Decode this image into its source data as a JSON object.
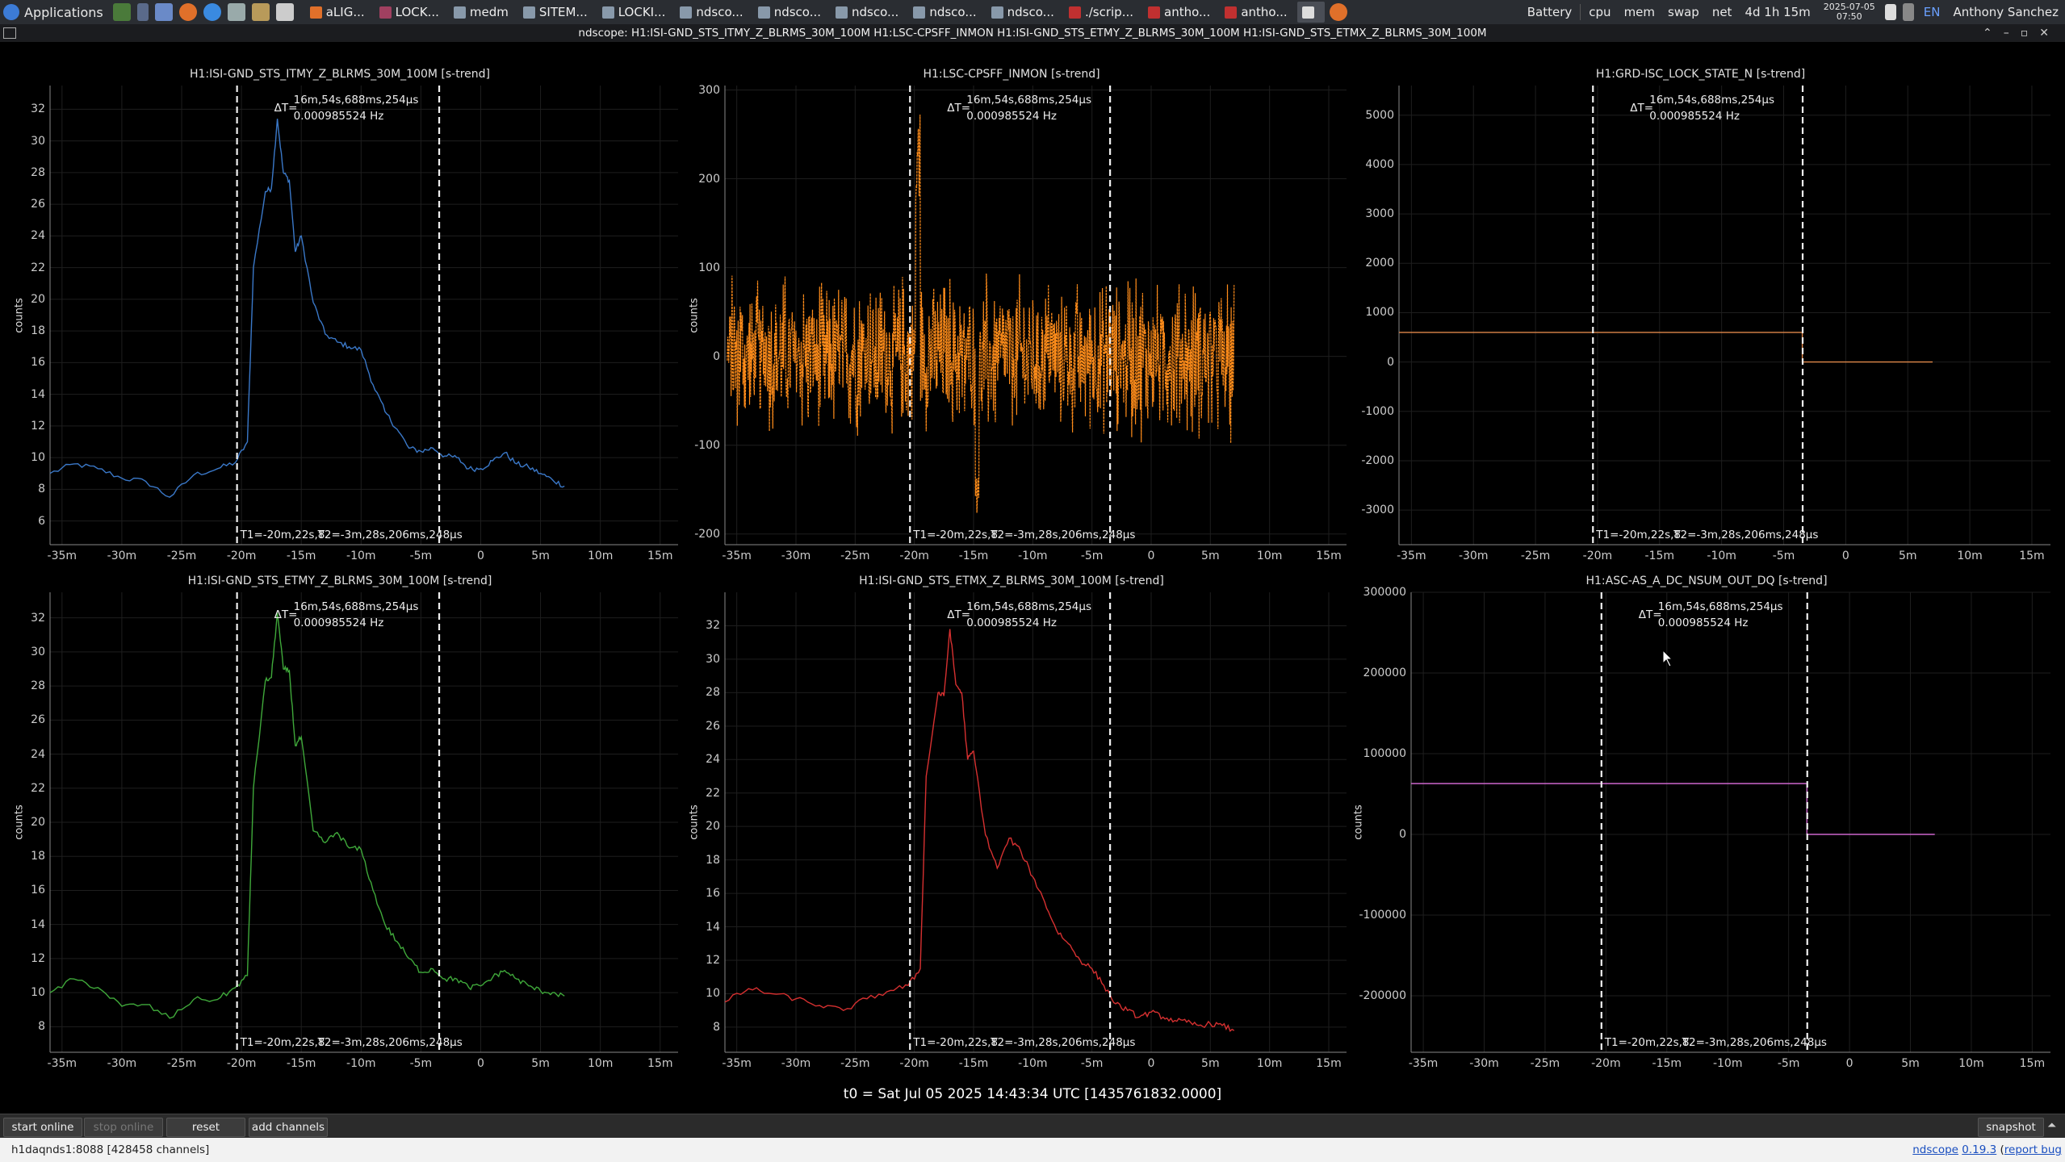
{
  "panel": {
    "applications_label": "Applications",
    "tasks": [
      {
        "label": "aLIG...",
        "icon": "firefox-icon"
      },
      {
        "label": "LOCK...",
        "icon": "x-icon"
      },
      {
        "label": "medm",
        "icon": "window-icon"
      },
      {
        "label": "SITEM...",
        "icon": "window-icon"
      },
      {
        "label": "LOCKI...",
        "icon": "window-icon"
      },
      {
        "label": "ndsco...",
        "icon": "window-icon"
      },
      {
        "label": "ndsco...",
        "icon": "window-icon"
      },
      {
        "label": "ndsco...",
        "icon": "window-icon"
      },
      {
        "label": "ndsco...",
        "icon": "window-icon"
      },
      {
        "label": "ndsco...",
        "icon": "window-icon"
      },
      {
        "label": "./scrip...",
        "icon": "terminal-icon"
      },
      {
        "label": "antho...",
        "icon": "terminal-icon"
      },
      {
        "label": "antho...",
        "icon": "terminal-icon"
      }
    ],
    "tray": {
      "battery": "Battery",
      "cpu": "cpu",
      "mem": "mem",
      "swap": "swap",
      "net": "net",
      "uptime": "4d 1h 15m",
      "date": "2025-07-05",
      "time": "07:50",
      "lang": "EN",
      "user": "Anthony Sanchez"
    }
  },
  "window": {
    "title": "ndscope: H1:ISI-GND_STS_ITMY_Z_BLRMS_30M_100M H1:LSC-CPSFF_INMON H1:ISI-GND_STS_ETMY_Z_BLRMS_30M_100M H1:ISI-GND_STS_ETMX_Z_BLRMS_30M_100M"
  },
  "cursors": {
    "delta_symbol": "ΔT=",
    "delta": "16m,54s,688ms,254μs",
    "freq": "0.000985524 Hz",
    "t1_full": "T1=-20m,22s,8",
    "t2_full": "T2=-3m,28s,206ms,248μs",
    "t1_value_min": -20.37,
    "t2_value_min": -3.47
  },
  "x_ticks": [
    "-35m",
    "-30m",
    "-25m",
    "-20m",
    "-15m",
    "-10m",
    "-5m",
    "0",
    "5m",
    "10m",
    "15m"
  ],
  "x_tick_values": [
    -35,
    -30,
    -25,
    -20,
    -15,
    -10,
    -5,
    0,
    5,
    10,
    15
  ],
  "t0_label": "t0 = Sat Jul 05 2025 14:43:34 UTC [1435761832.0000]",
  "chart_data": [
    {
      "type": "line",
      "title": "H1:ISI-GND_STS_ITMY_Z_BLRMS_30M_100M [s-trend]",
      "ylabel": "counts",
      "xlim": [
        -36,
        16.5
      ],
      "ylim": [
        4.5,
        33.5
      ],
      "y_ticks": [
        6,
        8,
        10,
        12,
        14,
        16,
        18,
        20,
        22,
        24,
        26,
        28,
        30,
        32
      ],
      "color": "#3a78c8",
      "x": [
        -36,
        -34,
        -32,
        -30,
        -28,
        -26,
        -24,
        -22,
        -20.5,
        -19.5,
        -19,
        -18,
        -17.5,
        -17,
        -16.5,
        -16,
        -15.5,
        -15,
        -14,
        -13,
        -12,
        -11,
        -10,
        -9,
        -8,
        -7,
        -6,
        -5,
        -4,
        -3,
        -2,
        -1,
        0,
        1,
        2,
        3,
        4,
        5,
        6,
        7
      ],
      "y": [
        9,
        9.6,
        9.3,
        8.7,
        8.5,
        7.5,
        8.9,
        9.3,
        9.7,
        11,
        22,
        26.8,
        27,
        31.4,
        28,
        27.5,
        23,
        24,
        19.8,
        17.8,
        17.3,
        17,
        16.8,
        14.6,
        12.9,
        11.8,
        10.6,
        10.4,
        10.6,
        10.1,
        10,
        9.3,
        9.3,
        9.8,
        10.3,
        9.6,
        9.4,
        9.0,
        8.6,
        8.2
      ]
    },
    {
      "type": "line",
      "title": "H1:LSC-CPSFF_INMON [s-trend]",
      "ylabel": "counts",
      "xlim": [
        -36,
        16.5
      ],
      "ylim": [
        -212,
        305
      ],
      "y_ticks": [
        -200,
        -100,
        0,
        100,
        200,
        300
      ],
      "color": "#ff8c1a",
      "band": {
        "x_start": -35.8,
        "x_end": 7,
        "min_typical": -100,
        "max_typical": 100,
        "peak_max": 280,
        "peak_x": -19.7,
        "floor_min": -195
      },
      "x": [],
      "y": []
    },
    {
      "type": "line",
      "title": "H1:GRD-ISC_LOCK_STATE_N [s-trend]",
      "ylabel": "",
      "xlim": [
        -36,
        16.5
      ],
      "ylim": [
        -3700,
        5600
      ],
      "y_ticks": [
        -3000,
        -2000,
        -1000,
        0,
        1000,
        2000,
        3000,
        4000,
        5000
      ],
      "color": "#e0884a",
      "x": [
        -36,
        -3.5,
        -3.5,
        7
      ],
      "y": [
        600,
        600,
        0,
        0
      ]
    },
    {
      "type": "line",
      "title": "H1:ISI-GND_STS_ETMY_Z_BLRMS_30M_100M [s-trend]",
      "ylabel": "counts",
      "xlim": [
        -36,
        16.5
      ],
      "ylim": [
        6.5,
        33.5
      ],
      "y_ticks": [
        8,
        10,
        12,
        14,
        16,
        18,
        20,
        22,
        24,
        26,
        28,
        30,
        32
      ],
      "color": "#3fa83a",
      "x": [
        -36,
        -34,
        -32,
        -30,
        -28,
        -26,
        -24,
        -22,
        -20.5,
        -19.5,
        -19,
        -18,
        -17.5,
        -17,
        -16.5,
        -16,
        -15.5,
        -15,
        -14,
        -13,
        -12,
        -11,
        -10,
        -9,
        -8,
        -7,
        -6,
        -5,
        -4,
        -3,
        -2,
        -1,
        0,
        1,
        2,
        3,
        4,
        5,
        6,
        7
      ],
      "y": [
        10,
        10.8,
        10.3,
        9.2,
        9.3,
        8.5,
        9.6,
        9.6,
        10.3,
        11,
        22,
        28.3,
        28.5,
        32.3,
        29,
        28.9,
        24.5,
        25,
        19.5,
        18.8,
        19.4,
        18.5,
        18.4,
        16,
        14,
        13,
        12,
        11.2,
        11.4,
        10.8,
        10.8,
        10.3,
        10.4,
        10.9,
        11.3,
        10.8,
        10.4,
        10.1,
        10,
        9.8
      ]
    },
    {
      "type": "line",
      "title": "H1:ISI-GND_STS_ETMX_Z_BLRMS_30M_100M [s-trend]",
      "ylabel": "counts",
      "xlim": [
        -36,
        16.5
      ],
      "ylim": [
        6.5,
        34
      ],
      "y_ticks": [
        8,
        10,
        12,
        14,
        16,
        18,
        20,
        22,
        24,
        26,
        28,
        30,
        32
      ],
      "color": "#d63030",
      "x": [
        -36,
        -34,
        -32,
        -30,
        -28,
        -26,
        -24,
        -22,
        -20.5,
        -19.5,
        -19,
        -18,
        -17.5,
        -17,
        -16.5,
        -16,
        -15.5,
        -15,
        -14,
        -13,
        -12,
        -11,
        -10,
        -9,
        -8,
        -7,
        -6,
        -5,
        -4,
        -3,
        -2,
        -1,
        0,
        1,
        2,
        3,
        4,
        5,
        6,
        7
      ],
      "y": [
        9.5,
        10.3,
        10,
        9.7,
        9.3,
        9,
        9.7,
        10.2,
        10.5,
        11.5,
        23,
        28,
        27.8,
        31.8,
        28.5,
        28,
        24,
        24.5,
        19.5,
        17.5,
        19.3,
        18.5,
        17,
        15.5,
        13.8,
        13,
        12,
        11.5,
        10.5,
        9.4,
        9,
        8.6,
        8.9,
        8.6,
        8.4,
        8.3,
        8.1,
        8.2,
        8.1,
        7.8
      ]
    },
    {
      "type": "line",
      "title": "H1:ASC-AS_A_DC_NSUM_OUT_DQ [s-trend]",
      "ylabel": "counts",
      "xlim": [
        -36,
        16.5
      ],
      "ylim": [
        -270000,
        300000
      ],
      "y_ticks": [
        -200000,
        -100000,
        0,
        100000,
        200000,
        300000
      ],
      "color": "#cc66cc",
      "x": [
        -36,
        -3.5,
        -3.5,
        7
      ],
      "y": [
        63000,
        63000,
        0,
        0
      ]
    }
  ],
  "bottom": {
    "start_online": "start online",
    "stop_online": "stop online",
    "reset": "reset",
    "add_channels": "add channels",
    "snapshot": "snapshot"
  },
  "status": {
    "server": "h1daqnds1:8088  [428458 channels]",
    "link_ndscope": "ndscope",
    "version": "0.19.3",
    "report": "report bug"
  }
}
